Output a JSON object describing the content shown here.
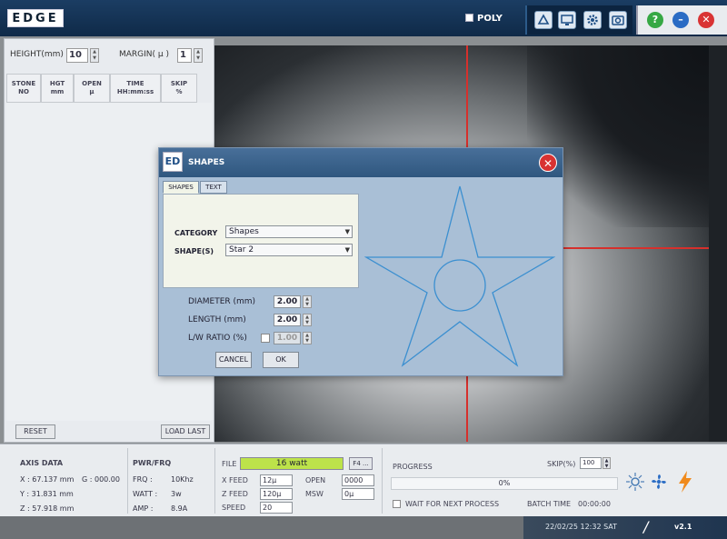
{
  "app": {
    "brand": "EDGE",
    "poly_label": "POLY"
  },
  "left": {
    "height_label": "HEIGHT(mm)",
    "height_value": "10",
    "margin_label": "MARGIN( µ )",
    "margin_value": "1",
    "columns": [
      {
        "line1": "STONE",
        "line2": "NO"
      },
      {
        "line1": "HGT",
        "line2": "mm"
      },
      {
        "line1": "OPEN",
        "line2": "µ"
      },
      {
        "line1": "TIME",
        "line2": "HH:mm:ss"
      },
      {
        "line1": "SKIP",
        "line2": "%"
      }
    ],
    "reset_label": "RESET",
    "load_last_label": "LOAD LAST"
  },
  "dialog": {
    "logo": "ED",
    "title": "SHAPES",
    "tabs": [
      "SHAPES",
      "TEXT"
    ],
    "category_label": "CATEGORY",
    "category_value": "Shapes",
    "shapes_label": "SHAPE(S)",
    "shape_value": "Star 2",
    "diameter_label": "DIAMETER (mm)",
    "diameter_value": "2.00",
    "length_label": "LENGTH (mm)",
    "length_value": "2.00",
    "ratio_label": "L/W RATIO (%)",
    "ratio_value": "1.00",
    "cancel_label": "CANCEL",
    "ok_label": "OK",
    "shape_color": "#3b8fd0"
  },
  "bottom": {
    "axis_title": "AXIS DATA",
    "x": "X : 67.137 mm",
    "y": "Y : 31.831 mm",
    "z": "Z : 57.918 mm",
    "g": "G : 000.00",
    "pwr_title": "PWR/FRQ",
    "frq_label": "FRQ :",
    "frq_value": "10Khz",
    "watt_label": "WATT :",
    "watt_value": "3w",
    "amp_label": "AMP :",
    "amp_value": "8.9A",
    "file_label": "FILE",
    "file_value": "16 watt",
    "f4_label": "F4 ...",
    "xfeed_label": "X FEED",
    "xfeed_value": "12µ",
    "zfeed_label": "Z FEED",
    "zfeed_value": "120µ",
    "speed_label": "SPEED",
    "speed_value": "20",
    "open_label": "OPEN",
    "open_value": "0000",
    "msw_label": "MSW",
    "msw_value": "0µ",
    "progress_title": "PROGRESS",
    "progress_value": "0%",
    "skip_label": "SKIP(%)",
    "skip_value": "100",
    "wait_label": "WAIT FOR NEXT PROCESS",
    "batch_label": "BATCH TIME",
    "batch_value": "00:00:00"
  },
  "status": {
    "datetime": "22/02/25 12:32 SAT",
    "sep": "/",
    "version": "v2.1"
  }
}
